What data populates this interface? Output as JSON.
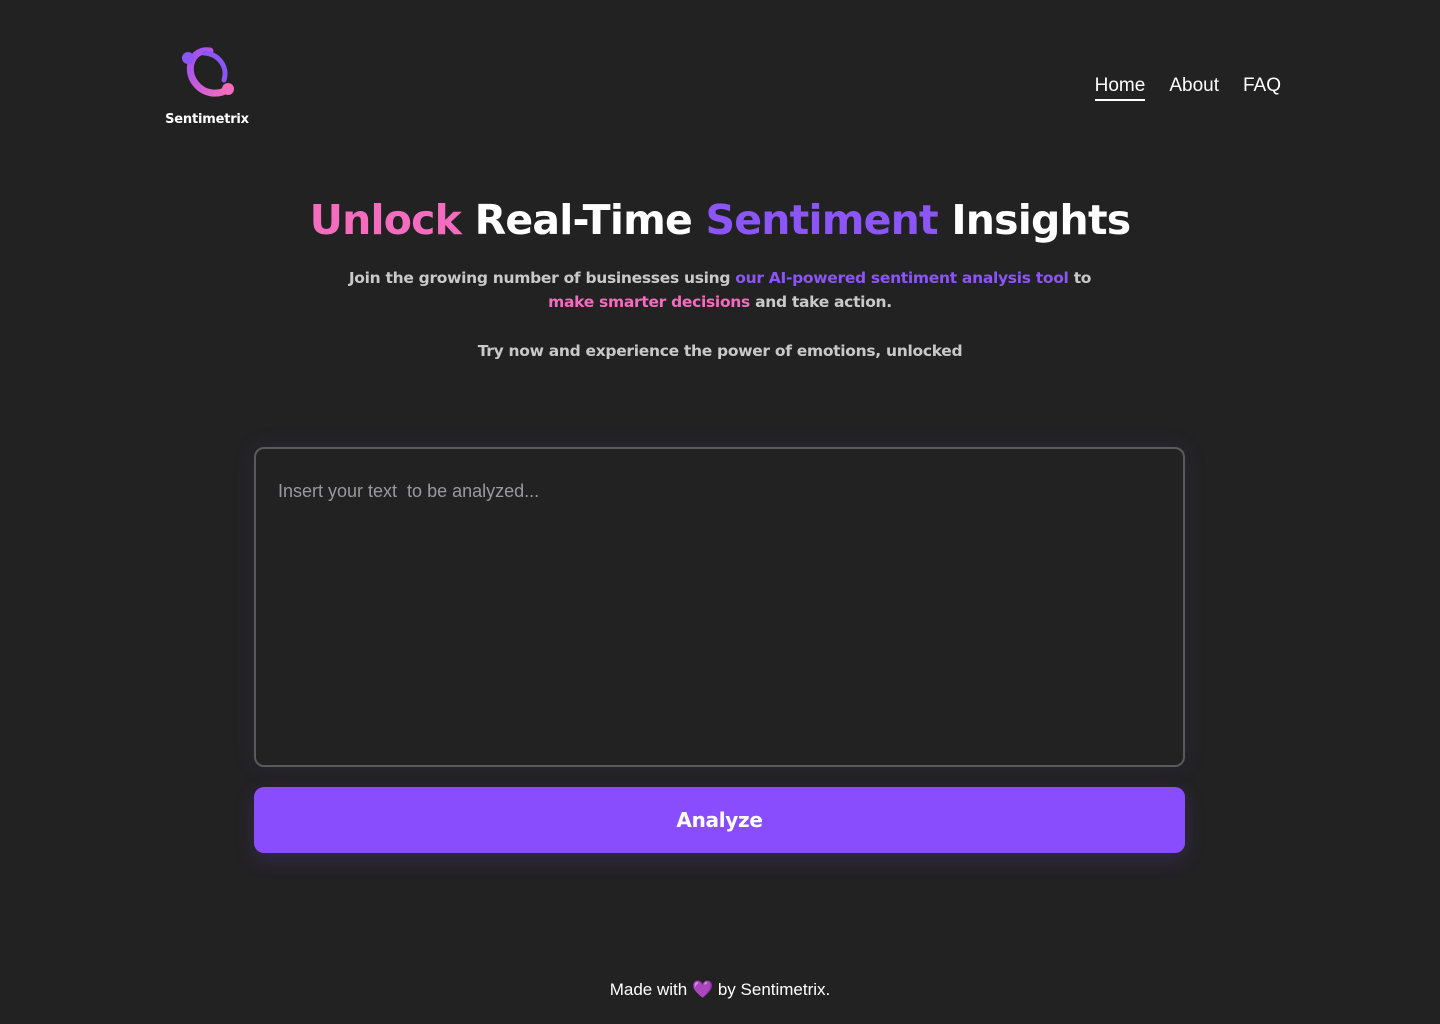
{
  "brand": {
    "name": "Sentimetrix",
    "colors": {
      "pink": "#f46cbd",
      "purple": "#8c55f7",
      "button": "#8a4dfd",
      "background": "#222223"
    }
  },
  "nav": {
    "items": [
      {
        "label": "Home",
        "active": true
      },
      {
        "label": "About",
        "active": false
      },
      {
        "label": "FAQ",
        "active": false
      }
    ]
  },
  "hero": {
    "title": {
      "word1": "Unlock",
      "word2": "Real-Time",
      "word3": "Sentiment",
      "word4": "Insights"
    },
    "subtitle": {
      "part1": "Join the growing number of businesses using",
      "highlight1": "our AI-powered sentiment analysis tool",
      "part2": "to",
      "highlight2": "make smarter decisions",
      "part3": "and take action."
    },
    "cta": "Try now and experience the power of emotions, unlocked"
  },
  "analyzer": {
    "input_value": "",
    "input_placeholder": "Insert your text  to be analyzed...",
    "button_label": "Analyze"
  },
  "footer": {
    "before": "Made with",
    "heart_icon": "purple-heart-icon",
    "heart": "💜",
    "after": "by Sentimetrix."
  }
}
